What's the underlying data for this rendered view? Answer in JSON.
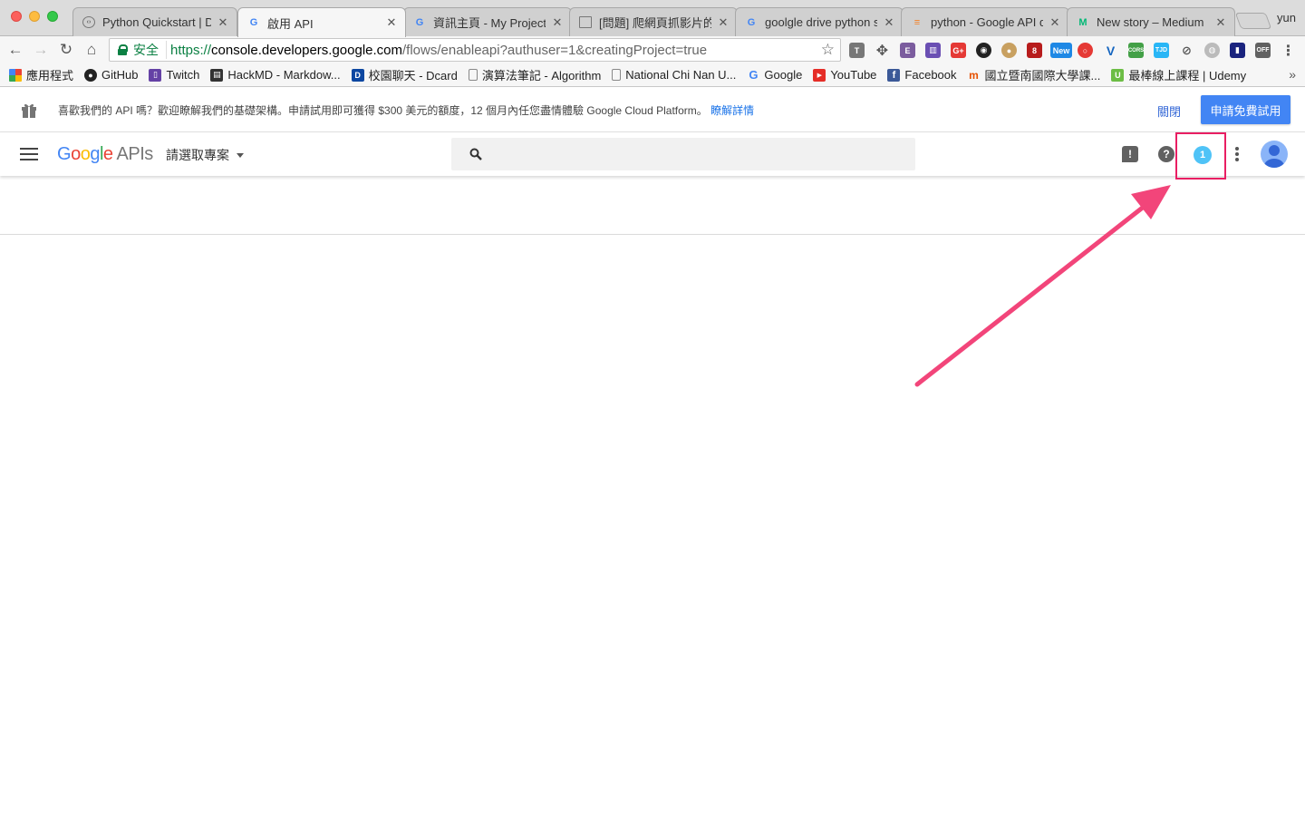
{
  "browser": {
    "profile_name": "yun",
    "tabs": [
      {
        "title": "Python Quickstart  |  D",
        "favicon": "code-icon",
        "active": false
      },
      {
        "title": "啟用 API",
        "favicon": "google-icon",
        "active": true
      },
      {
        "title": "資訊主頁 - My Project",
        "favicon": "google-icon",
        "active": false
      },
      {
        "title": "[問題] 爬網頁抓影片的",
        "favicon": "page-icon",
        "active": false
      },
      {
        "title": "goolgle drive python s",
        "favicon": "google-icon",
        "active": false
      },
      {
        "title": "python - Google API q",
        "favicon": "stackoverflow-icon",
        "active": false
      },
      {
        "title": "New story – Medium",
        "favicon": "medium-icon",
        "active": false
      }
    ],
    "omnibox": {
      "secure_label": "安全",
      "url_protocol": "https://",
      "url_host": "console.developers.google.com",
      "url_rest": "/flows/enableapi?authuser=1&creatingProject=true"
    },
    "bookmarks": [
      {
        "label": "應用程式",
        "icon": "apps-icon"
      },
      {
        "label": "GitHub",
        "icon": "github-icon"
      },
      {
        "label": "Twitch",
        "icon": "twitch-icon"
      },
      {
        "label": "HackMD - Markdow...",
        "icon": "hackmd-icon"
      },
      {
        "label": "校園聊天 - Dcard",
        "icon": "dcard-icon"
      },
      {
        "label": "演算法筆記 - Algorithm",
        "icon": "page-icon"
      },
      {
        "label": "National Chi Nan U...",
        "icon": "page-icon"
      },
      {
        "label": "Google",
        "icon": "google-icon"
      },
      {
        "label": "YouTube",
        "icon": "youtube-icon"
      },
      {
        "label": "Facebook",
        "icon": "facebook-icon"
      },
      {
        "label": "國立暨南國際大學課...",
        "icon": "ncnu-icon"
      },
      {
        "label": "最棒線上課程 | Udemy",
        "icon": "udemy-icon"
      }
    ],
    "bookmarks_more": "»"
  },
  "promo": {
    "message": "喜歡我們的 API 嗎？歡迎瞭解我們的基礎架構。申請試用即可獲得 $300 美元的額度，12 個月內任您盡情體驗 Google Cloud Platform。",
    "learn_more": "瞭解詳情",
    "close_label": "關閉",
    "trial_label": "申請免費試用"
  },
  "appbar": {
    "logo_google": [
      "G",
      "o",
      "o",
      "g",
      "l",
      "e"
    ],
    "logo_suffix": "APIs",
    "project_label": "請選取專案",
    "notification_count": "1",
    "feedback_glyph": "!",
    "help_glyph": "?"
  },
  "colors": {
    "accent": "#4285f4",
    "highlight": "#e91e63",
    "badge": "#4fc3f7",
    "secure": "#0b8043"
  }
}
